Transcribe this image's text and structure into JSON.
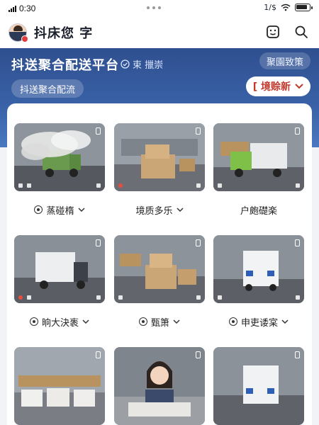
{
  "status": {
    "time": "0:30",
    "right_text": "1/$"
  },
  "header": {
    "app_name": "抖床您 字"
  },
  "banner": {
    "title": "抖送聚合配送平台",
    "verified": "束 擸崇",
    "policy_button": "聚園致策",
    "tag": "抖送聚合配流",
    "filter": "[ 境赊新"
  },
  "grid": [
    {
      "label": "蒸碰楕",
      "left_icon": true,
      "chevron": true,
      "scene": "truck-smoke",
      "liked": false
    },
    {
      "label": "境质多乐",
      "left_icon": false,
      "chevron": true,
      "scene": "boxes-warehouse",
      "liked": true
    },
    {
      "label": "户皰礎楽",
      "left_icon": false,
      "chevron": false,
      "scene": "green-truck",
      "liked": false
    },
    {
      "label": "晌大決袠",
      "left_icon": true,
      "chevron": true,
      "scene": "white-van",
      "liked": true
    },
    {
      "label": "甄箫",
      "left_icon": true,
      "chevron": true,
      "scene": "boxes-pile",
      "liked": false
    },
    {
      "label": "申吏诿宲",
      "left_icon": true,
      "chevron": true,
      "scene": "van-rear",
      "liked": false
    },
    {
      "label": "",
      "left_icon": false,
      "chevron": false,
      "scene": "boxes-floor",
      "liked": false
    },
    {
      "label": "",
      "left_icon": false,
      "chevron": false,
      "scene": "worker",
      "liked": false
    },
    {
      "label": "",
      "left_icon": false,
      "chevron": false,
      "scene": "van-rear-2",
      "liked": false
    }
  ],
  "icons": {
    "signal": "signal-icon",
    "wifi": "wifi-icon",
    "battery": "battery-icon",
    "scan": "scan-icon",
    "search": "search-icon",
    "verified": "check-circle-icon",
    "chevron": "chevron-down-icon",
    "heart": "heart-icon"
  },
  "colors": {
    "banner": "#3a62a8",
    "accent_red": "#c0392b",
    "heart": "#e74c3c"
  }
}
